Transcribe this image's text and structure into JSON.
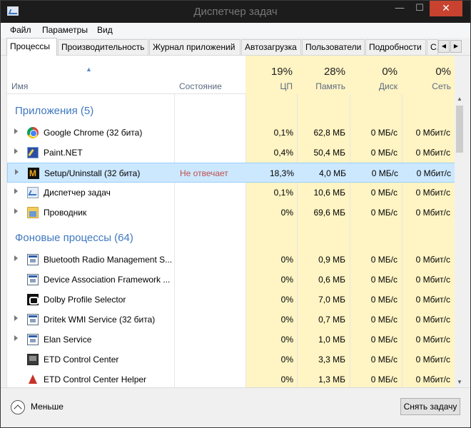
{
  "window": {
    "title": "Диспетчер задач"
  },
  "titlebar": {
    "minimize": "—",
    "maximize": "☐",
    "close": "✕"
  },
  "menu": [
    "Файл",
    "Параметры",
    "Вид"
  ],
  "tabs": [
    "Процессы",
    "Производительность",
    "Журнал приложений",
    "Автозагрузка",
    "Пользователи",
    "Подробности",
    "С..."
  ],
  "tab_scroll": {
    "left": "◀",
    "right": "▶"
  },
  "columns": {
    "name": "Имя",
    "status": "Состояние",
    "cpu": {
      "label": "ЦП",
      "percent": "19%"
    },
    "memory": {
      "label": "Память",
      "percent": "28%"
    },
    "disk": {
      "label": "Диск",
      "percent": "0%"
    },
    "network": {
      "label": "Сеть",
      "percent": "0%"
    }
  },
  "sort_arrow": "▲",
  "groups": {
    "apps": "Приложения (5)",
    "background": "Фоновые процессы (64)"
  },
  "apps": [
    {
      "name": "Google Chrome (32 бита)",
      "status": "",
      "cpu": "0,1%",
      "memory": "62,8 МБ",
      "disk": "0 МБ/с",
      "network": "0 Мбит/с",
      "icon": "chrome-icon"
    },
    {
      "name": "Paint.NET",
      "status": "",
      "cpu": "0,4%",
      "memory": "50,4 МБ",
      "disk": "0 МБ/с",
      "network": "0 Мбит/с",
      "icon": "paintnet-icon"
    },
    {
      "name": "Setup/Uninstall (32 бита)",
      "status": "Не отвечает",
      "cpu": "18,3%",
      "memory": "4,0 МБ",
      "disk": "0 МБ/с",
      "network": "0 Мбит/с",
      "icon": "setup-icon"
    },
    {
      "name": "Диспетчер задач",
      "status": "",
      "cpu": "0,1%",
      "memory": "10,6 МБ",
      "disk": "0 МБ/с",
      "network": "0 Мбит/с",
      "icon": "task-manager-icon"
    },
    {
      "name": "Проводник",
      "status": "",
      "cpu": "0%",
      "memory": "69,6 МБ",
      "disk": "0 МБ/с",
      "network": "0 Мбит/с",
      "icon": "explorer-folder-icon"
    }
  ],
  "background": [
    {
      "name": "Bluetooth Radio Management S...",
      "cpu": "0%",
      "memory": "0,9 МБ",
      "disk": "0 МБ/с",
      "network": "0 Мбит/с",
      "icon": "service-window-icon"
    },
    {
      "name": "Device Association Framework ...",
      "cpu": "0%",
      "memory": "0,6 МБ",
      "disk": "0 МБ/с",
      "network": "0 Мбит/с",
      "icon": "service-window-icon"
    },
    {
      "name": "Dolby Profile Selector",
      "cpu": "0%",
      "memory": "7,0 МБ",
      "disk": "0 МБ/с",
      "network": "0 Мбит/с",
      "icon": "dolby-icon"
    },
    {
      "name": "Dritek WMI Service (32 бита)",
      "cpu": "0%",
      "memory": "0,7 МБ",
      "disk": "0 МБ/с",
      "network": "0 Мбит/с",
      "icon": "service-window-icon"
    },
    {
      "name": "Elan Service",
      "cpu": "0%",
      "memory": "1,0 МБ",
      "disk": "0 МБ/с",
      "network": "0 Мбит/с",
      "icon": "service-window-icon"
    },
    {
      "name": "ETD Control Center",
      "cpu": "0%",
      "memory": "3,3 МБ",
      "disk": "0 МБ/с",
      "network": "0 Мбит/с",
      "icon": "etd-icon"
    },
    {
      "name": "ETD Control Center Helper",
      "cpu": "0%",
      "memory": "1,3 МБ",
      "disk": "0 МБ/с",
      "network": "0 Мбит/с",
      "icon": "etd-helper-icon"
    }
  ],
  "footer": {
    "less": "Меньше",
    "end_task": "Снять задачу"
  },
  "scrollbar": {
    "up": "▲",
    "down": "▼"
  },
  "colors": {
    "cpu_heat": "#fff4c4",
    "cpu_heat_strong": "#f9eca8",
    "selection": "#cce8ff",
    "group_text": "#3f78c0",
    "status_text": "#c0504d",
    "close_button": "#c7432f"
  }
}
